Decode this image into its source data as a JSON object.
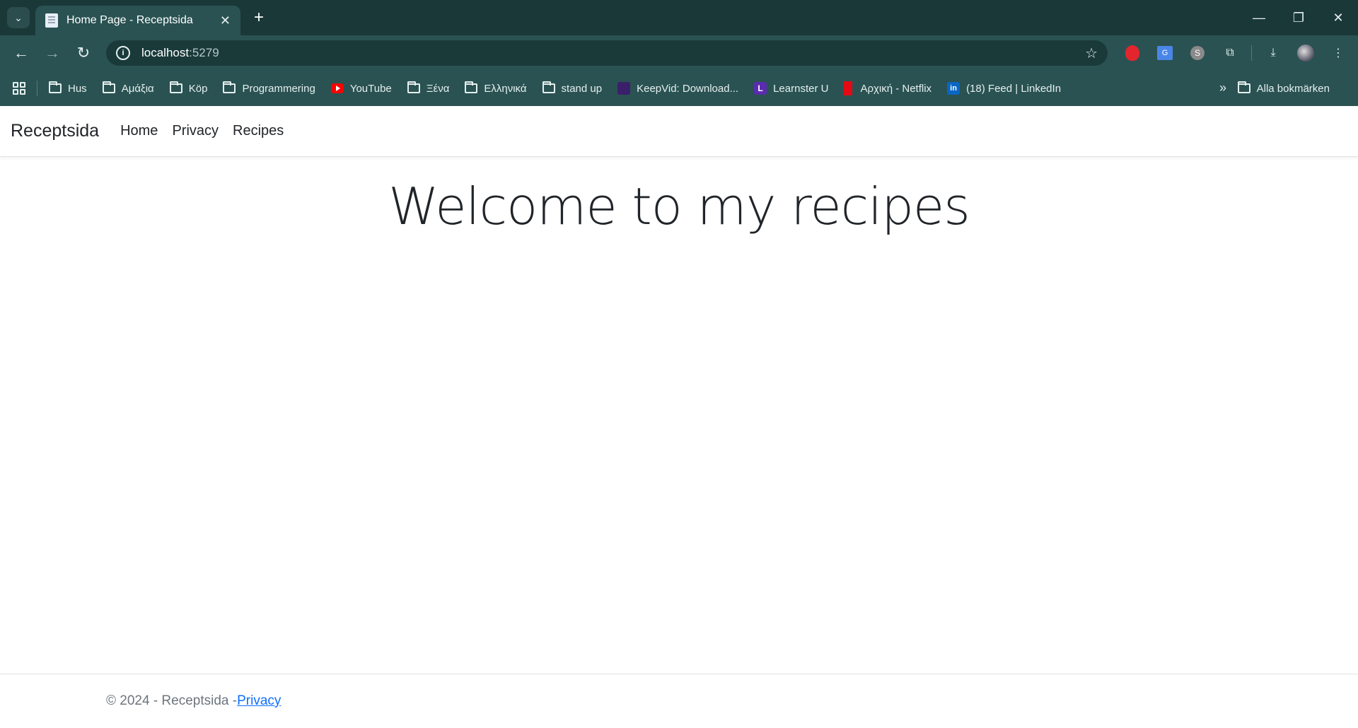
{
  "browser": {
    "tab_title": "Home Page - Receptsida",
    "url_host": "localhost",
    "url_port": ":5279"
  },
  "bookmarks": [
    {
      "label": "Hus",
      "icon": "folder-icon"
    },
    {
      "label": "Αμάξια",
      "icon": "folder-icon"
    },
    {
      "label": "Köp",
      "icon": "folder-icon"
    },
    {
      "label": "Programmering",
      "icon": "folder-icon"
    },
    {
      "label": "YouTube",
      "icon": "youtube-icon"
    },
    {
      "label": "Ξένα",
      "icon": "folder-icon"
    },
    {
      "label": "Ελληνικά",
      "icon": "folder-icon"
    },
    {
      "label": "stand up",
      "icon": "folder-icon"
    },
    {
      "label": "KeepVid: Download...",
      "icon": "keepvid-icon"
    },
    {
      "label": "Learnster U",
      "icon": "learnster-icon"
    },
    {
      "label": "Αρχική - Netflix",
      "icon": "netflix-icon"
    },
    {
      "label": "(18) Feed | LinkedIn",
      "icon": "linkedin-icon"
    }
  ],
  "all_bookmarks_label": "Alla bokmärken",
  "site": {
    "brand": "Receptsida",
    "nav": [
      "Home",
      "Privacy",
      "Recipes"
    ],
    "heading": "Welcome to my recipes",
    "footer_text": "© 2024 - Receptsida - ",
    "footer_link": "Privacy"
  }
}
